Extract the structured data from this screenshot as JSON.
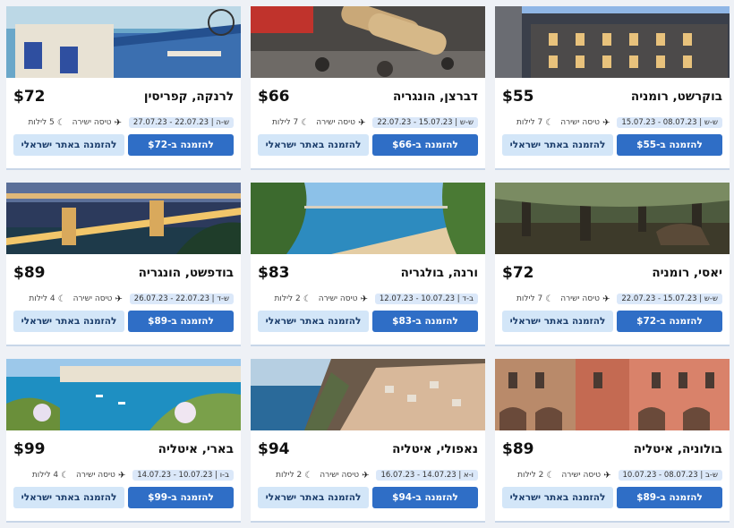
{
  "accent_color": "#2f6ec6",
  "secondary_button_color": "#d3e6f8",
  "cards": [
    {
      "city": "לרנקה, קפריסין",
      "price": "$72",
      "dates": "22.07.23 - 27.07.23",
      "days": "ש-ה",
      "flight": "טיסה ישירה",
      "nights": "5 לילות",
      "book_label": "להזמנה ב-$72",
      "israeli_label": "להזמנה באתר ישראלי"
    },
    {
      "city": "דברצן, הונגריה",
      "price": "$66",
      "dates": "15.07.23 - 22.07.23",
      "days": "ש-ש",
      "flight": "טיסה ישירה",
      "nights": "7 לילות",
      "book_label": "להזמנה ב-$66",
      "israeli_label": "להזמנה באתר ישראלי"
    },
    {
      "city": "בוקרשט, רומניה",
      "price": "$55",
      "dates": "08.07.23 - 15.07.23",
      "days": "ש-ש",
      "flight": "טיסה ישירה",
      "nights": "7 לילות",
      "book_label": "להזמנה ב-$55",
      "israeli_label": "להזמנה באתר ישראלי"
    },
    {
      "city": "בודפשט, הונגריה",
      "price": "$89",
      "dates": "22.07.23 - 26.07.23",
      "days": "ש-ד",
      "flight": "טיסה ישירה",
      "nights": "4 לילות",
      "book_label": "להזמנה ב-$89",
      "israeli_label": "להזמנה באתר ישראלי"
    },
    {
      "city": "ורנה, בולגריה",
      "price": "$83",
      "dates": "10.07.23 - 12.07.23",
      "days": "ב-ד",
      "flight": "טיסה ישירה",
      "nights": "2 לילות",
      "book_label": "להזמנה ב-$83",
      "israeli_label": "להזמנה באתר ישראלי"
    },
    {
      "city": "יאסי, רומניה",
      "price": "$72",
      "dates": "15.07.23 - 22.07.23",
      "days": "ש-ש",
      "flight": "טיסה ישירה",
      "nights": "7 לילות",
      "book_label": "להזמנה ב-$72",
      "israeli_label": "להזמנה באתר ישראלי"
    },
    {
      "city": "בארי, איטליה",
      "price": "$99",
      "dates": "10.07.23 - 14.07.23",
      "days": "ב-ו",
      "flight": "טיסה ישירה",
      "nights": "4 לילות",
      "book_label": "להזמנה ב-$99",
      "israeli_label": "להזמנה באתר ישראלי"
    },
    {
      "city": "נאפולי, איטליה",
      "price": "$94",
      "dates": "14.07.23 - 16.07.23",
      "days": "ו-א",
      "flight": "טיסה ישירה",
      "nights": "2 לילות",
      "book_label": "להזמנה ב-$94",
      "israeli_label": "להזמנה באתר ישראלי"
    },
    {
      "city": "בולוניה, איטליה",
      "price": "$89",
      "dates": "08.07.23 - 10.07.23",
      "days": "ש-ב",
      "flight": "טיסה ישירה",
      "nights": "2 לילות",
      "book_label": "להזמנה ב-$89",
      "israeli_label": "להזמנה באתר ישראלי"
    }
  ]
}
